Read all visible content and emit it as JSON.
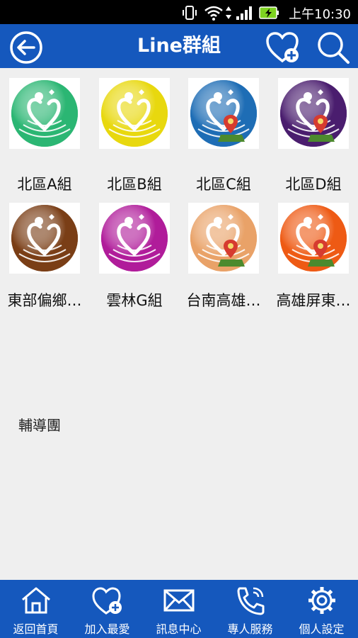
{
  "status_bar": {
    "time": "上午10:30"
  },
  "header": {
    "title": "Line群組"
  },
  "groups": [
    {
      "label": "北區A組",
      "color": "#2bb673"
    },
    {
      "label": "北區B組",
      "color": "#e8d80e"
    },
    {
      "label": "北區C組",
      "color": "#1e6db5"
    },
    {
      "label": "北區D組",
      "color": "#4a1d6e"
    },
    {
      "label": "東部偏鄉…",
      "color": "#7a3e16"
    },
    {
      "label": "雲林G組",
      "color": "#b01c9a"
    },
    {
      "label": "台南高雄…",
      "color": "#e9a268"
    },
    {
      "label": "高雄屏東…",
      "color": "#ee5a14"
    }
  ],
  "section_label": "輔導團",
  "bottom_nav": [
    {
      "label": "返回首頁",
      "icon": "home-icon",
      "active": true
    },
    {
      "label": "加入最愛",
      "icon": "heart-plus-icon",
      "active": false
    },
    {
      "label": "訊息中心",
      "icon": "mail-icon",
      "active": false
    },
    {
      "label": "專人服務",
      "icon": "phone-icon",
      "active": false
    },
    {
      "label": "個人設定",
      "icon": "gear-icon",
      "active": false
    }
  ]
}
